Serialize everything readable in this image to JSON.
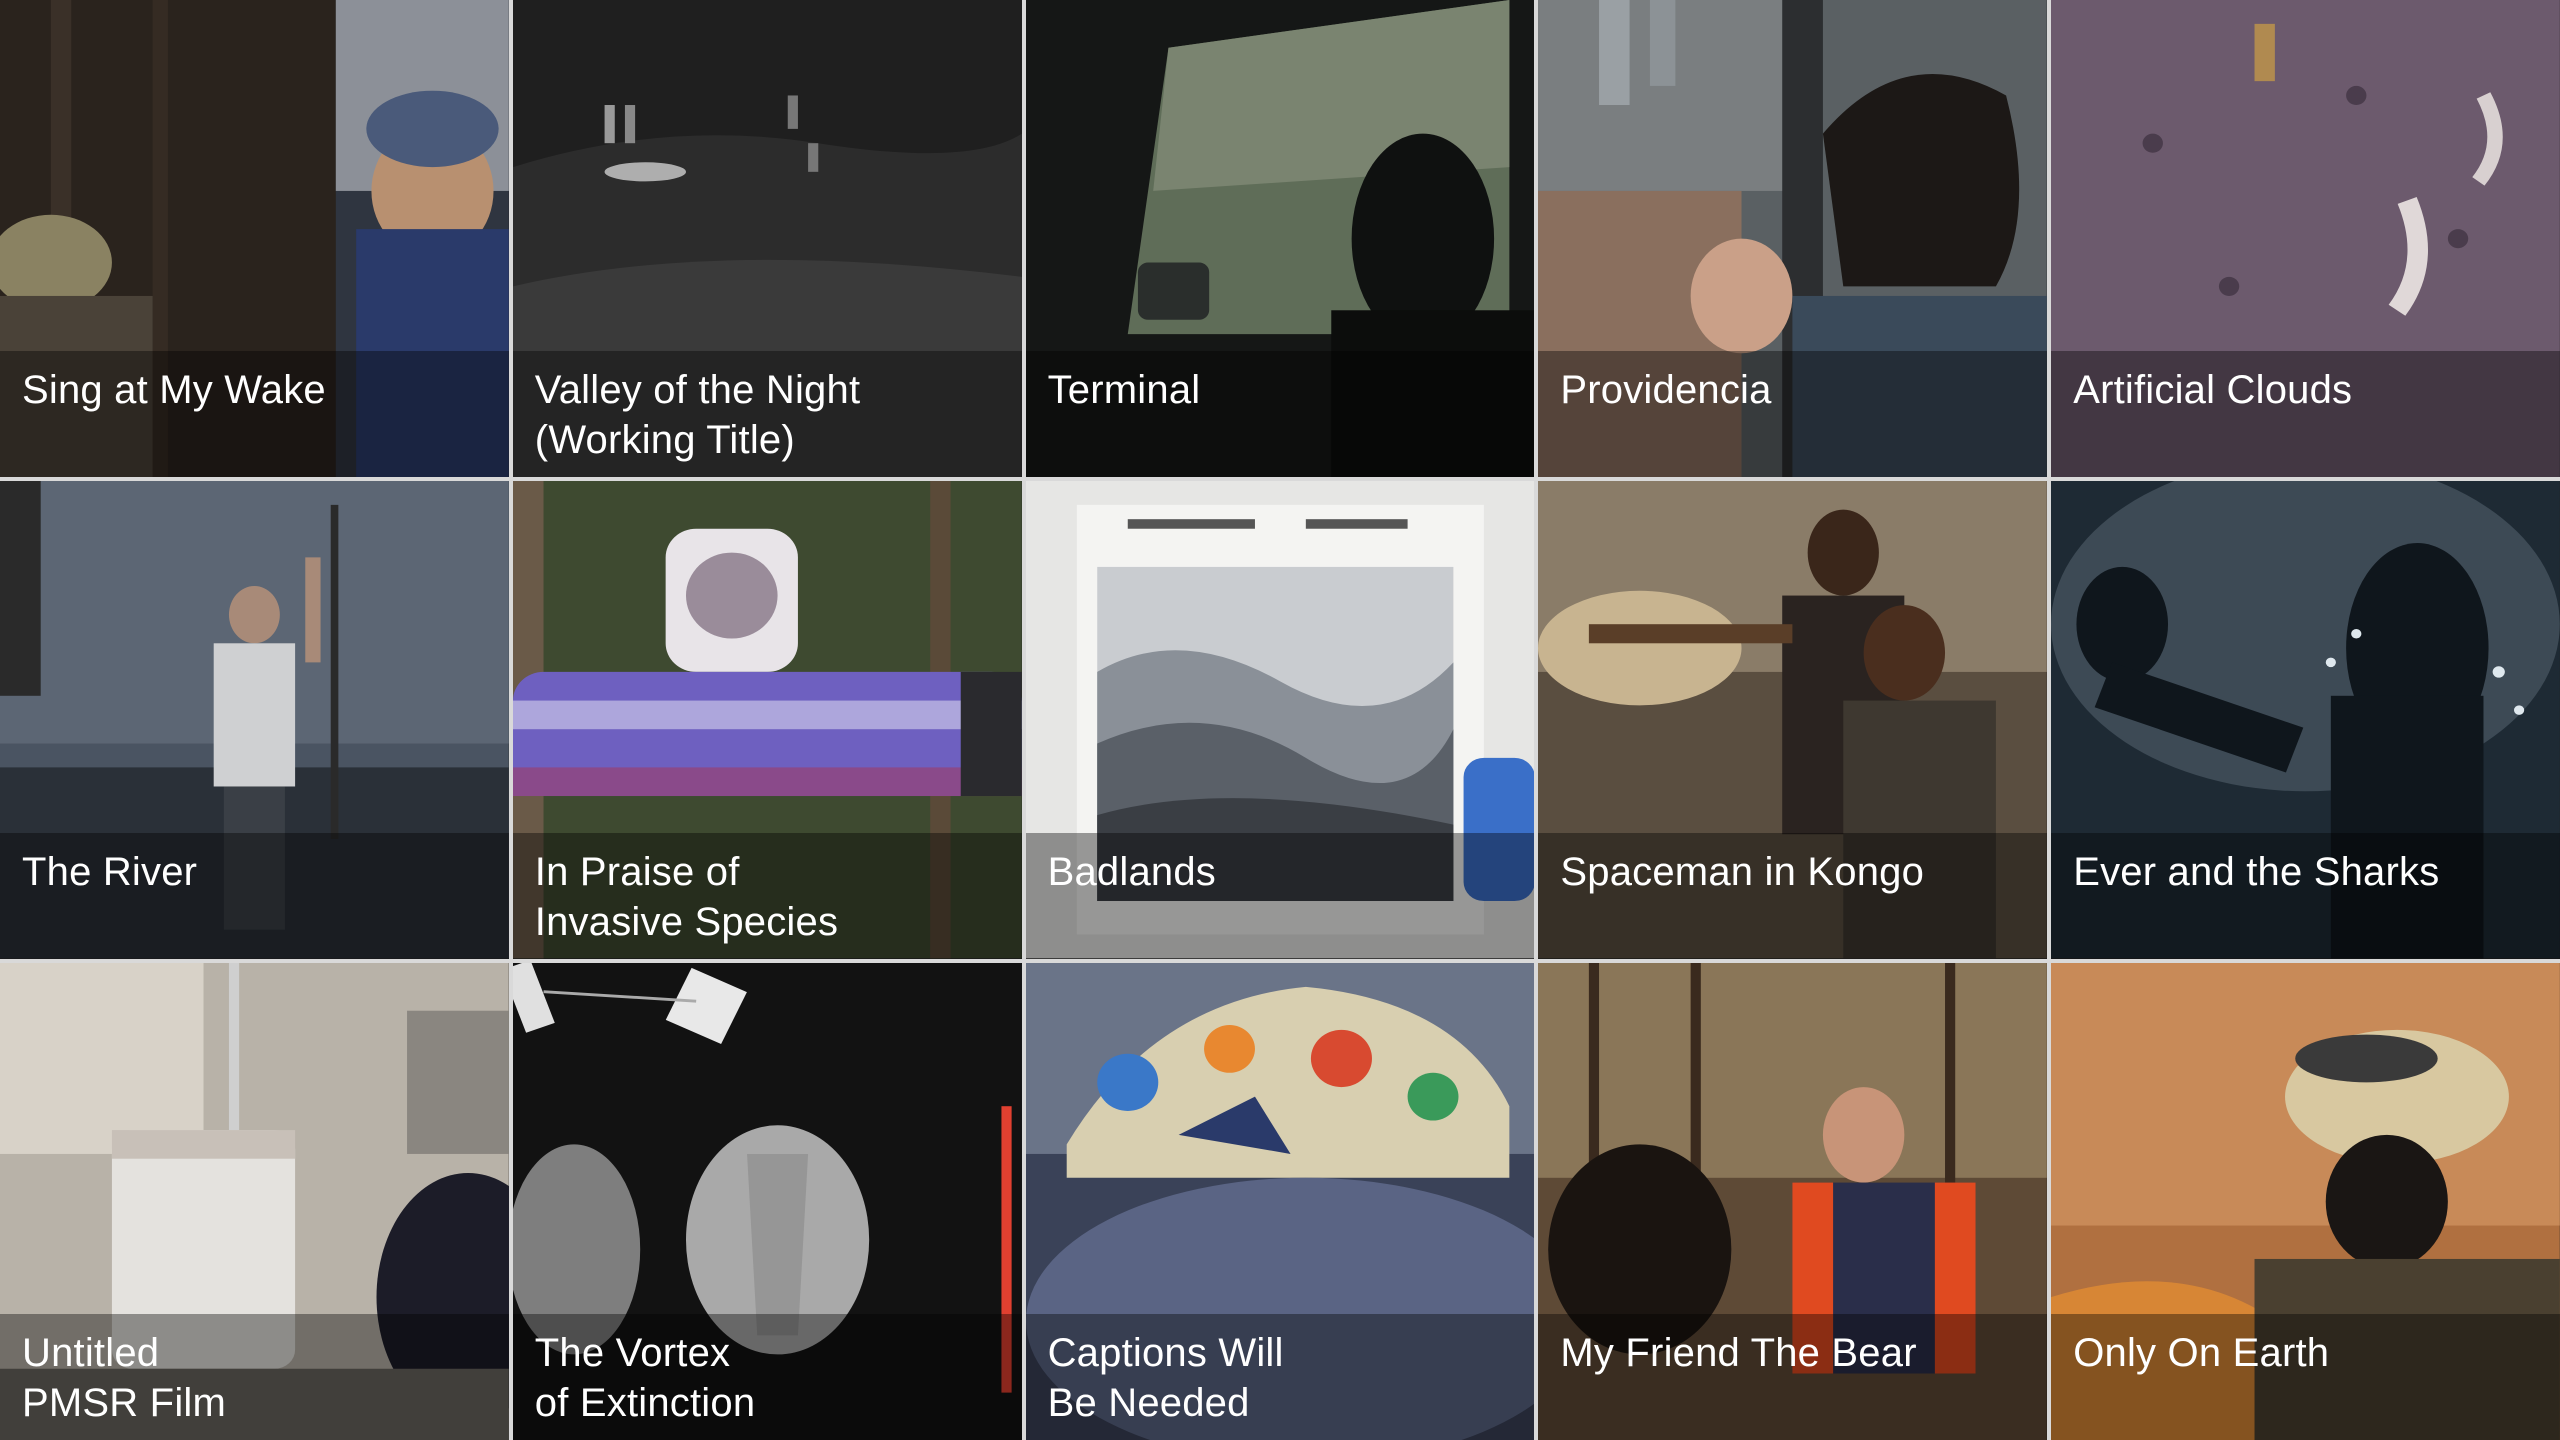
{
  "films": [
    {
      "title": "Sing at My Wake",
      "thumb": "two elderly people by a tree trunk",
      "colors": [
        "#3a2f28",
        "#1c1a17",
        "#5a6a88"
      ]
    },
    {
      "title": "Valley of the Night\n(Working Title)",
      "thumb": "hikers with flashlights on night hillside",
      "colors": [
        "#2b2b2b",
        "#141414",
        "#5a5a5a"
      ]
    },
    {
      "title": "Terminal",
      "thumb": "silhouette driver in car at dusk",
      "colors": [
        "#2e3432",
        "#101211",
        "#6f7c66"
      ]
    },
    {
      "title": "Providencia",
      "thumb": "woman holding child looking up over city",
      "colors": [
        "#4b5256",
        "#2a2e31",
        "#8a6e5c"
      ]
    },
    {
      "title": "Artificial Clouds",
      "thumb": "figure walking across purple ground with pipes",
      "colors": [
        "#6b5a6e",
        "#3d3140",
        "#9b8794"
      ]
    },
    {
      "title": "The River",
      "thumb": "man on sailboat reaching up rigging",
      "colors": [
        "#3c4552",
        "#1d232b",
        "#6e7a88"
      ]
    },
    {
      "title": "In Praise of\nInvasive Species",
      "thumb": "transparent cylinder with purple contents in forest",
      "colors": [
        "#3b4a2c",
        "#1f2818",
        "#6a5ad0"
      ]
    },
    {
      "title": "Badlands",
      "thumb": "archival negative photo of badlands landscape",
      "colors": [
        "#e8e8e6",
        "#b8bcc0",
        "#3a6fc8"
      ]
    },
    {
      "title": "Spaceman in Kongo",
      "thumb": "two men standing beside rocket engine",
      "colors": [
        "#6b5d4c",
        "#2e2824",
        "#a89072"
      ]
    },
    {
      "title": "Ever and the Sharks",
      "thumb": "silhouette under water with bubbles",
      "colors": [
        "#2a3844",
        "#101820",
        "#5f7380"
      ]
    },
    {
      "title": "Untitled\nPMSR Film",
      "thumb": "lab vials in cryo container",
      "colors": [
        "#9c9890",
        "#5c5a56",
        "#d8d4cc"
      ]
    },
    {
      "title": "The Vortex\nof Extinction",
      "thumb": "x-ray of turtles with tags",
      "colors": [
        "#1c1c1c",
        "#0a0a0a",
        "#c8c8c8"
      ]
    },
    {
      "title": "Captions Will\nBe Needed",
      "thumb": "beaded cap on head against sky",
      "colors": [
        "#6a7690",
        "#303850",
        "#d88a3a"
      ]
    },
    {
      "title": "My Friend The Bear",
      "thumb": "man in orange vest with bear in forest",
      "colors": [
        "#5a4a3a",
        "#2a231c",
        "#d84a2a"
      ]
    },
    {
      "title": "Only On Earth",
      "thumb": "firefighter with helmet and smoke",
      "colors": [
        "#a86a3a",
        "#4a2a1a",
        "#e8c8a0"
      ]
    }
  ]
}
